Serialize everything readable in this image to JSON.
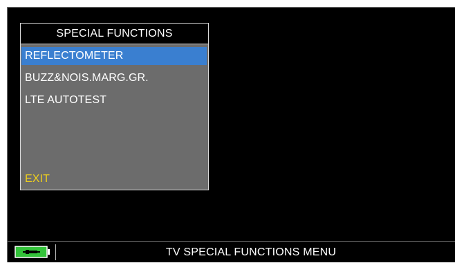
{
  "menu": {
    "title": "SPECIAL FUNCTIONS",
    "items": [
      {
        "label": "REFLECTOMETER",
        "selected": true
      },
      {
        "label": "BUZZ&NOIS.MARG.GR.",
        "selected": false
      },
      {
        "label": "LTE AUTOTEST",
        "selected": false
      }
    ],
    "exit_label": "EXIT"
  },
  "status_bar": {
    "battery_icon": "battery-icon",
    "text": "TV SPECIAL FUNCTIONS MENU"
  },
  "colors": {
    "screen_background": "#000000",
    "panel_background": "#6c6c6c",
    "selection": "#3a7fd0",
    "exit_text": "#f2d21a",
    "battery_fill": "#33c33a"
  }
}
